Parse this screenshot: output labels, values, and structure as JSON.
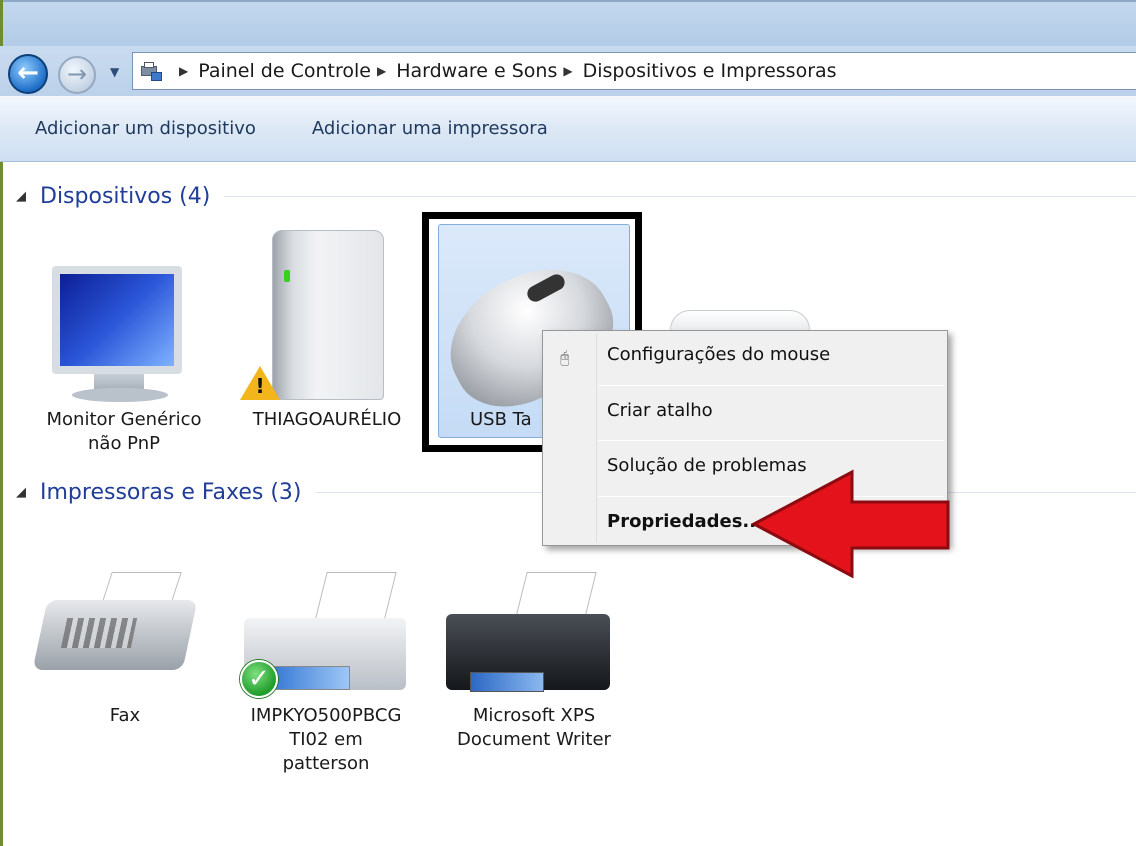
{
  "address": {
    "crumbs": [
      "Painel de Controle",
      "Hardware e Sons",
      "Dispositivos e Impressoras"
    ]
  },
  "toolbar": {
    "add_device": "Adicionar um dispositivo",
    "add_printer": "Adicionar uma impressora"
  },
  "groups": {
    "devices": "Dispositivos (4)",
    "printers": "Impressoras e Faxes (3)"
  },
  "devices": [
    {
      "label": "Monitor Genérico",
      "label2": "não PnP",
      "icon": "monitor-icon"
    },
    {
      "label": "THIAGOAURÉLIO",
      "icon": "computer-tower-icon",
      "status": "warning"
    },
    {
      "label": "USB Ta",
      "icon": "mouse-icon",
      "selected": true
    }
  ],
  "printers": [
    {
      "label": "Fax",
      "icon": "fax-icon"
    },
    {
      "label": "IMPKYO500PBCG",
      "label2": "TI02 em",
      "label3": "patterson",
      "icon": "printer-icon",
      "status": "default"
    },
    {
      "label": "Microsoft XPS",
      "label2": "Document Writer",
      "icon": "printer-icon"
    }
  ],
  "context_menu": {
    "items": [
      "Configurações do mouse",
      "Criar atalho",
      "Solução de problemas",
      "Propriedades..."
    ],
    "bold_item": "Propriedades..."
  },
  "colors": {
    "group_header": "#1f3d99",
    "toolbar_text": "#1e395b",
    "annotation_arrow": "#e3121b"
  }
}
